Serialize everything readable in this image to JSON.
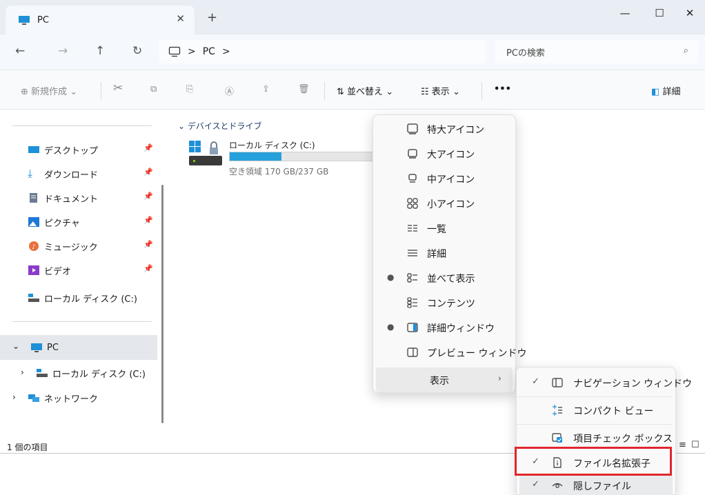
{
  "tab": {
    "title": "PC"
  },
  "address": {
    "root": ">",
    "pc": "PC",
    "sep": ">"
  },
  "search": {
    "placeholder": "PCの検索",
    "icon": "search-icon"
  },
  "toolbar": {
    "new_label": "新規作成",
    "sort_label": "並べ替え",
    "view_label": "表示",
    "more_label": "•••",
    "details_label": "詳細"
  },
  "sidebar": {
    "pinned": [
      {
        "label": "デスクトップ",
        "icon": "desktop-icon",
        "color": "#1e90d8"
      },
      {
        "label": "ダウンロード",
        "icon": "download-icon",
        "color": "#1e90d8"
      },
      {
        "label": "ドキュメント",
        "icon": "document-icon",
        "color": "#6a7c92"
      },
      {
        "label": "ピクチャ",
        "icon": "picture-icon",
        "color": "#1e78d8"
      },
      {
        "label": "ミュージック",
        "icon": "music-icon",
        "color": "#e8703a"
      },
      {
        "label": "ビデオ",
        "icon": "video-icon",
        "color": "#8a3cc8"
      }
    ],
    "local_disk": "ローカル ディスク (C:)",
    "pc": "PC",
    "pc_disk": "ローカル ディスク (C:)",
    "network": "ネットワーク"
  },
  "content": {
    "group_header": "デバイスとドライブ",
    "drive_name": "ローカル ディスク (C:)",
    "drive_free": "空き領域 170 GB/237 GB",
    "drive_used_fraction": 0.28
  },
  "status": {
    "item_count": "1 個の項目"
  },
  "view_menu": [
    {
      "label": "特大アイコン",
      "icon": "extra-large-icons-icon",
      "dot": false
    },
    {
      "label": "大アイコン",
      "icon": "large-icons-icon",
      "dot": false
    },
    {
      "label": "中アイコン",
      "icon": "medium-icons-icon",
      "dot": false
    },
    {
      "label": "小アイコン",
      "icon": "small-icons-icon",
      "dot": false
    },
    {
      "label": "一覧",
      "icon": "list-icon",
      "dot": false
    },
    {
      "label": "詳細",
      "icon": "details-icon",
      "dot": false
    },
    {
      "label": "並べて表示",
      "icon": "tiles-icon",
      "dot": true
    },
    {
      "label": "コンテンツ",
      "icon": "content-icon",
      "dot": false
    },
    {
      "label": "詳細ウィンドウ",
      "icon": "details-pane-icon",
      "dot": true
    },
    {
      "label": "プレビュー ウィンドウ",
      "icon": "preview-pane-icon",
      "dot": false
    },
    {
      "label": "表示",
      "icon": "",
      "dot": false,
      "submenu": true
    }
  ],
  "show_submenu": [
    {
      "label": "ナビゲーション ウィンドウ",
      "icon": "navigation-pane-icon",
      "checked": true
    },
    {
      "label": "コンパクト ビュー",
      "icon": "compact-view-icon",
      "checked": false
    },
    {
      "label": "項目チェック ボックス",
      "icon": "item-checkbox-icon",
      "checked": false
    },
    {
      "label": "ファイル名拡張子",
      "icon": "file-extension-icon",
      "checked": true
    },
    {
      "label": "隠しファイル",
      "icon": "hidden-files-icon",
      "checked": true
    }
  ],
  "colors": {
    "accent": "#1e90d8",
    "highlight": "#e0262c"
  }
}
